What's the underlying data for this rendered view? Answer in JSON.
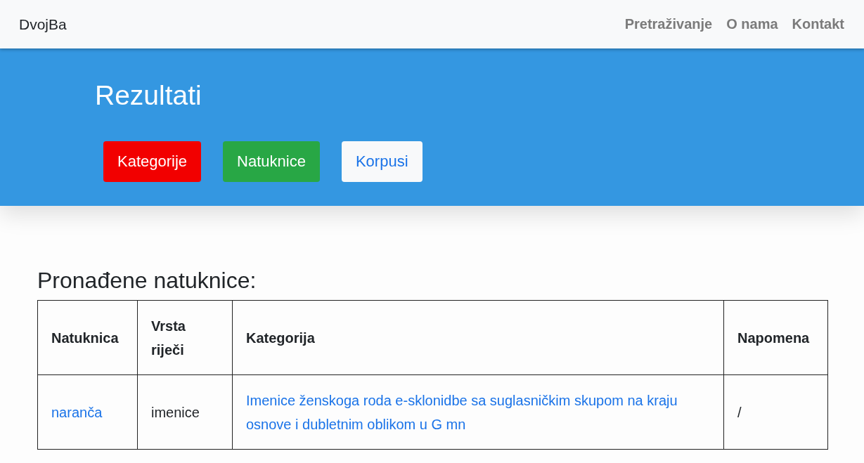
{
  "navbar": {
    "brand": "DvojBa",
    "links": [
      "Pretraživanje",
      "O nama",
      "Kontakt"
    ]
  },
  "header": {
    "title": "Rezultati",
    "buttons": [
      {
        "label": "Kategorije",
        "kind": "danger"
      },
      {
        "label": "Natuknice",
        "kind": "success"
      },
      {
        "label": "Korpusi",
        "kind": "light"
      }
    ]
  },
  "results": {
    "heading": "Pronađene natuknice:",
    "columns": [
      "Natuknica",
      "Vrsta riječi",
      "Kategorija",
      "Napomena"
    ],
    "rows": [
      [
        {
          "text": "naranča",
          "link": true
        },
        {
          "text": "imenice",
          "link": false
        },
        {
          "text": "Imenice ženskoga roda e-sklonidbe sa suglasničkim skupom na kraju osnove i dubletnim oblikom u G mn",
          "link": true
        },
        {
          "text": "/",
          "link": false
        }
      ]
    ]
  }
}
